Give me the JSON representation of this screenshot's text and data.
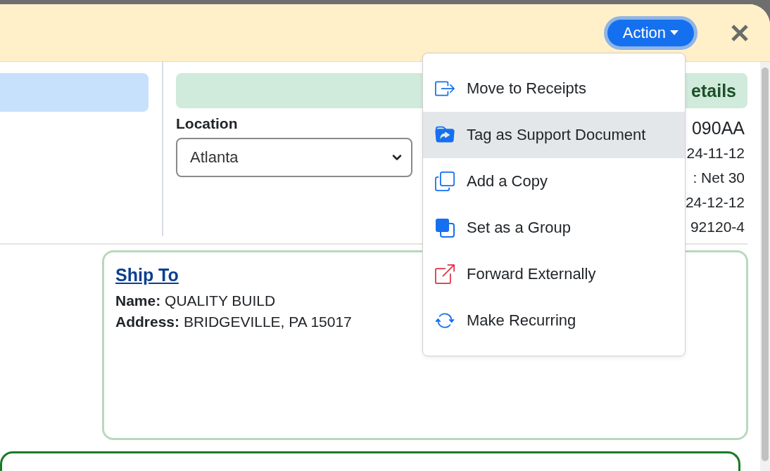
{
  "header": {
    "action_button": {
      "label": "Action"
    }
  },
  "details_header": {
    "label": "etails"
  },
  "location": {
    "label": "Location",
    "value": "Atlanta"
  },
  "details_values": [
    "090AA",
    "24-11-12",
    ": Net 30",
    "24-12-12",
    "92120-4"
  ],
  "ship_to": {
    "title": "Ship To",
    "fields": [
      {
        "label": "Name:",
        "value": "QUALITY BUILD"
      },
      {
        "label": "Address:",
        "value": "BRIDGEVILLE, PA 15017"
      }
    ]
  },
  "action_menu": {
    "items": [
      {
        "label": "Move to Receipts",
        "selected": false
      },
      {
        "label": "Tag as Support Document",
        "selected": true
      },
      {
        "label": "Add a Copy",
        "selected": false
      },
      {
        "label": "Set as a Group",
        "selected": false
      },
      {
        "label": "Forward Externally",
        "selected": false
      },
      {
        "label": "Make Recurring",
        "selected": false
      }
    ]
  }
}
